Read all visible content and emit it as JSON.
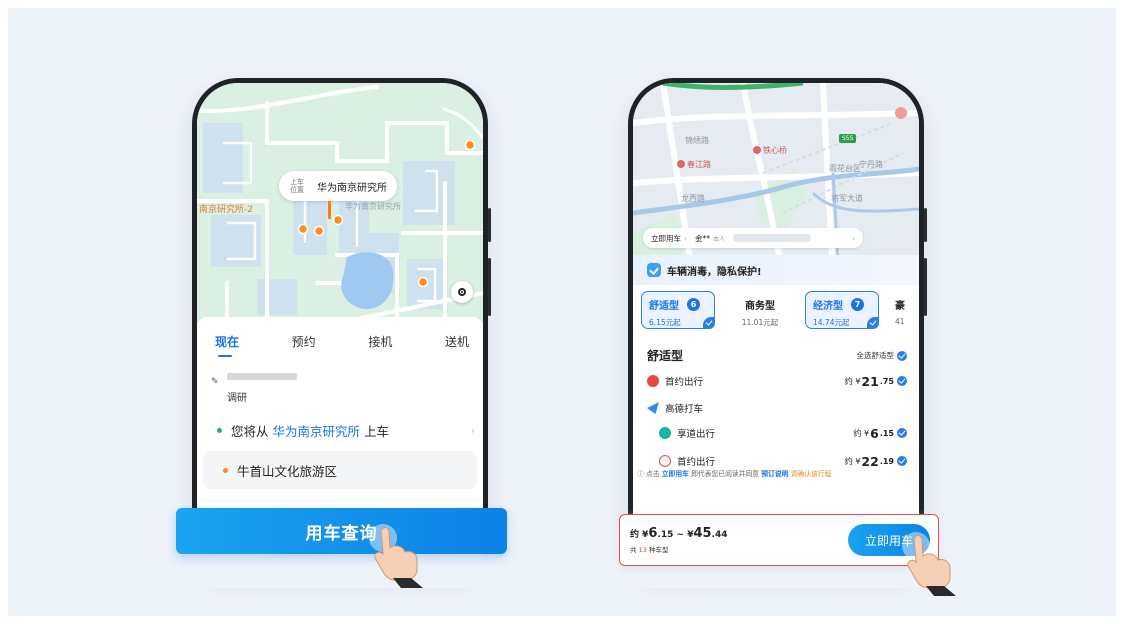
{
  "left_phone": {
    "pin": {
      "tag_line1": "上车",
      "tag_line2": "位置",
      "name": "华为南京研究所"
    },
    "map_labels": {
      "west": "南京研究所-2",
      "building": "华为南京研究所"
    },
    "tabs": [
      {
        "label": "现在",
        "active": true
      },
      {
        "label": "预约",
        "active": false
      },
      {
        "label": "接机",
        "active": false
      },
      {
        "label": "送机",
        "active": false
      }
    ],
    "note": {
      "icon": "note-icon",
      "text": "调研"
    },
    "from": {
      "prefix": "您将从",
      "place": "华为南京研究所",
      "suffix": "上车",
      "bullet_color": "#1db079"
    },
    "to": {
      "place": "牛首山文化旅游区",
      "bullet_color": "#ff8a1f"
    },
    "cta_label": "用车查询"
  },
  "right_phone": {
    "map_labels": {
      "road1": "锦绣路",
      "road2": "龙西路",
      "road3": "将军大道",
      "road4": "宁丹路",
      "poi1": "铁心桥",
      "poi2": "春江路",
      "poi3": "雨花台区",
      "road_badge": "S55"
    },
    "address_pill": {
      "mode": "立即用车",
      "passenger": "金**",
      "passenger_tag": "本人"
    },
    "banner": "车辆消毒，隐私保护!",
    "car_types": [
      {
        "name": "舒适型",
        "count": "6",
        "price": "6.15元起",
        "selected": true
      },
      {
        "name": "商务型",
        "count": "",
        "price": "11.01元起",
        "selected": false
      },
      {
        "name": "经济型",
        "count": "7",
        "price": "14.74元起",
        "selected": true
      },
      {
        "name": "豪",
        "count": "",
        "price": "41",
        "selected": false
      }
    ],
    "section": {
      "title": "舒适型",
      "select_all": "全选舒适型"
    },
    "providers": [
      {
        "name": "首约出行",
        "price_prefix": "约 ¥",
        "price_main": "21",
        "price_sub": ".75",
        "logo_color": "#e84a3f",
        "indent": false,
        "checked": true
      },
      {
        "name": "高德打车",
        "price_prefix": "",
        "price_main": "",
        "price_sub": "",
        "logo_color": "#2d8cf0",
        "indent": false,
        "checked": false
      },
      {
        "name": "享道出行",
        "price_prefix": "约 ¥",
        "price_main": "6",
        "price_sub": ".15",
        "logo_color": "#15b59e",
        "indent": true,
        "checked": true
      },
      {
        "name": "首约出行",
        "price_prefix": "约 ¥",
        "price_main": "22",
        "price_sub": ".19",
        "logo_color": "#f0f0f0",
        "indent": true,
        "checked": true
      }
    ],
    "terms": {
      "t1": "点击",
      "t2": "立即用车",
      "t3": "即代表您已阅读并同意",
      "t4": "预订说明",
      "t5": "请确认该行程"
    },
    "summary": {
      "range_prefix": "约 ¥",
      "range_low": "6",
      "range_low_sub": ".15",
      "range_sep": " ~ ¥",
      "range_high": "45",
      "range_high_sub": ".44",
      "count_prefix": "共",
      "count": "13",
      "count_suffix": "种车型"
    },
    "book_label": "立即用车"
  },
  "colors": {
    "accent": "#1a73e8",
    "button": "#0c82e8",
    "orange": "#ff8a1f",
    "map_green": "#dff1e6"
  }
}
